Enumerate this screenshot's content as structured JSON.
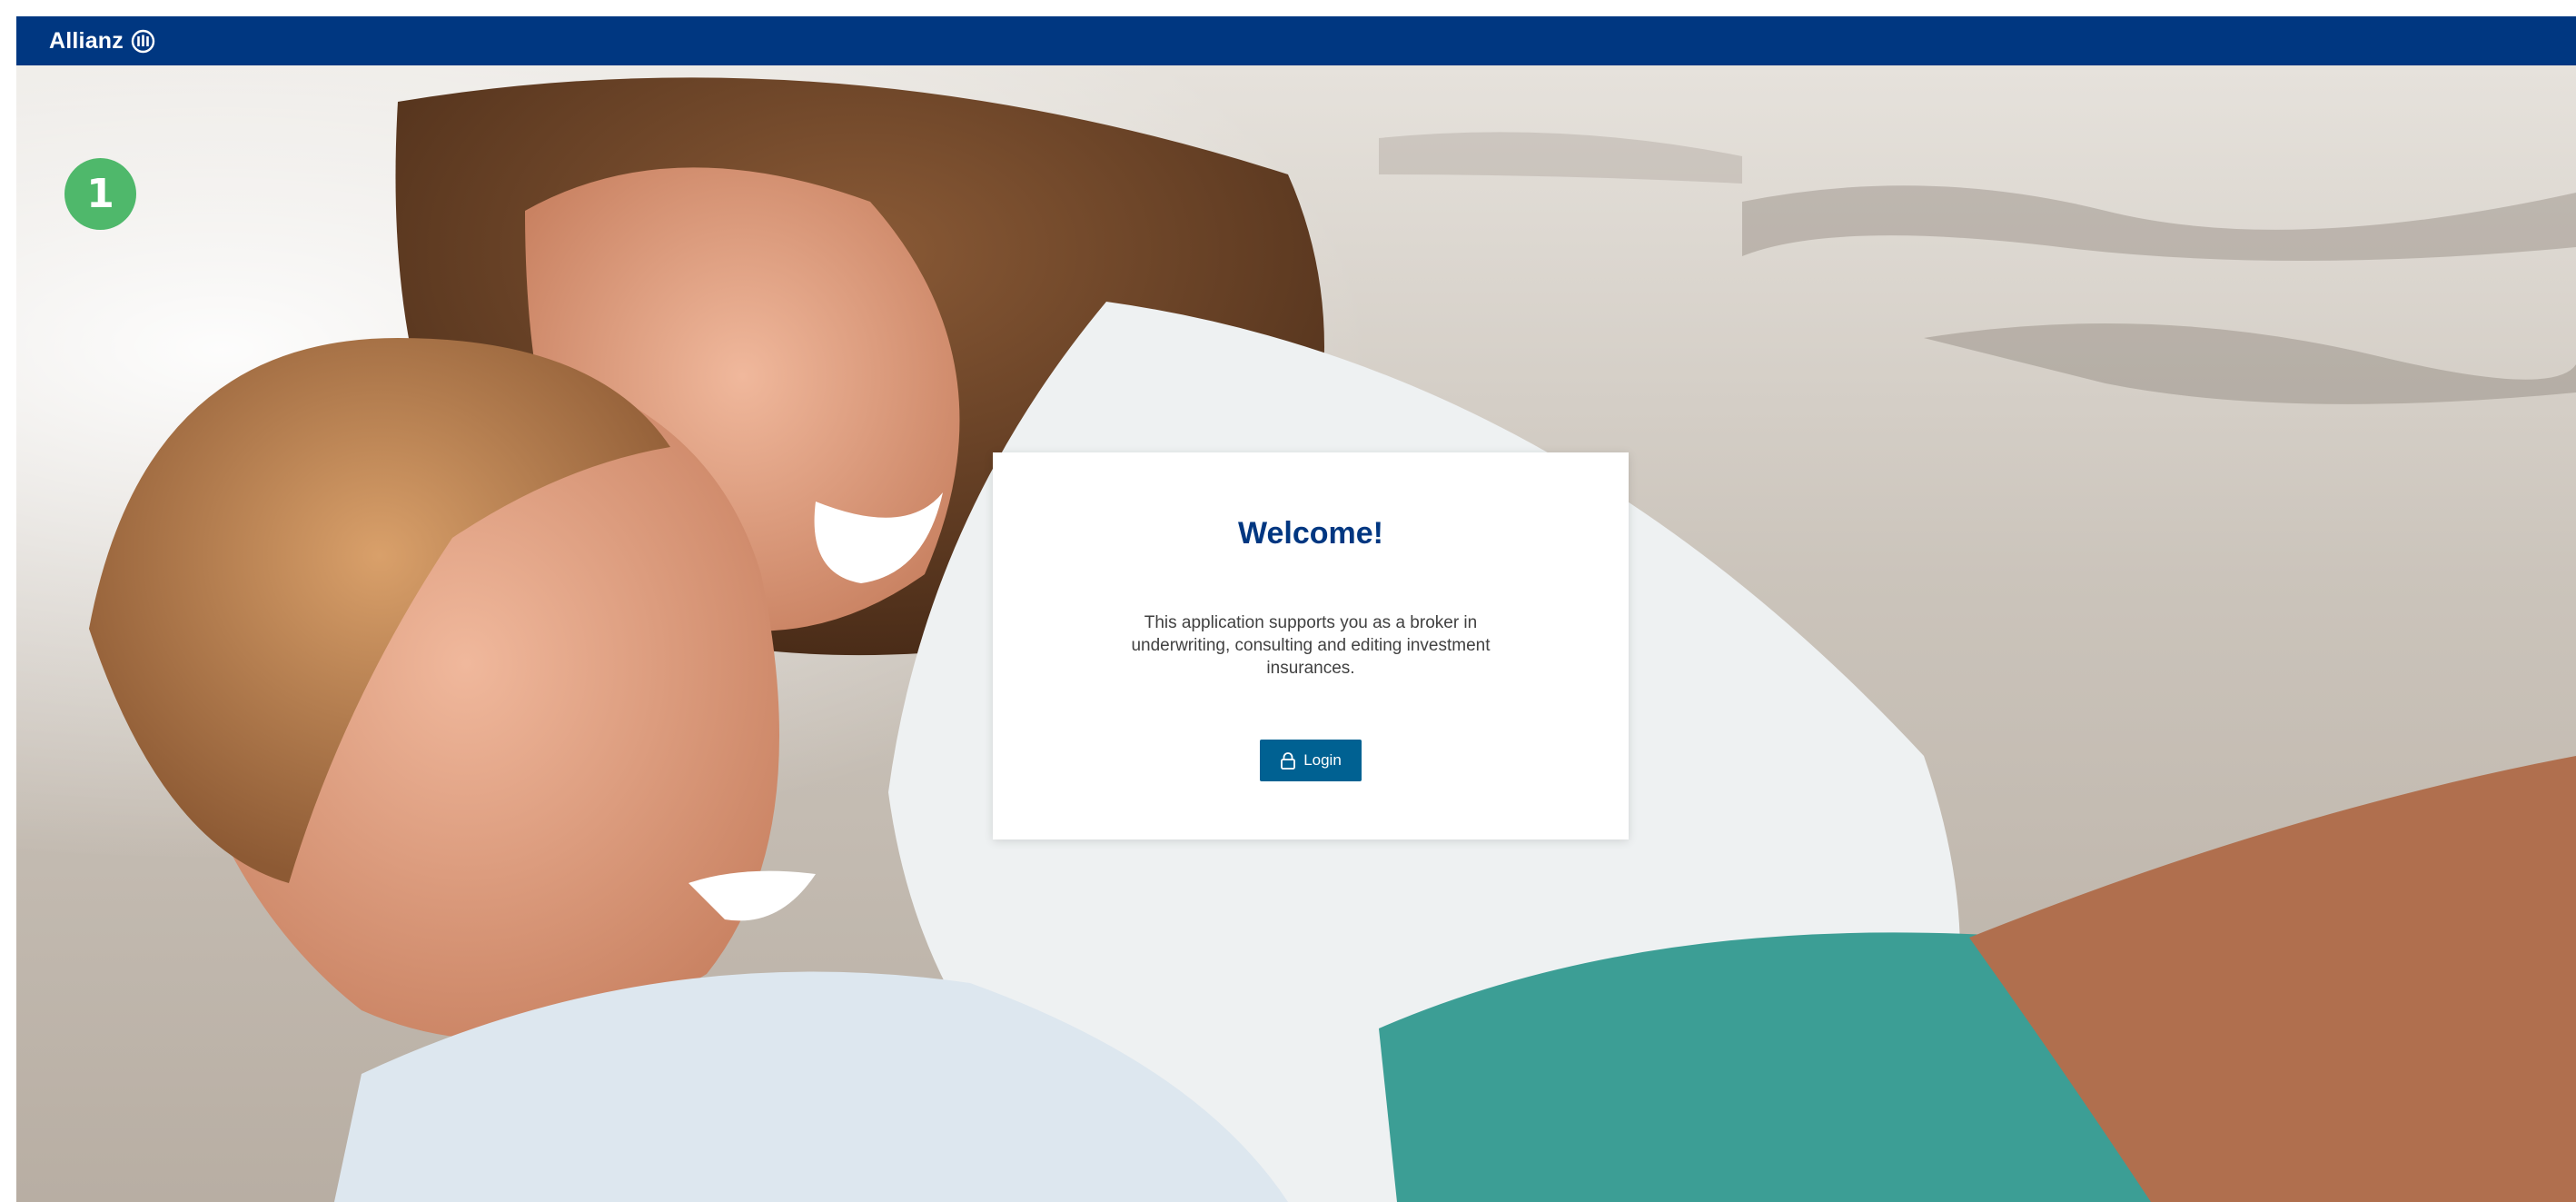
{
  "header": {
    "brand": "Allianz",
    "logo_icon": "allianz-eagle-icon",
    "background_color": "#003781"
  },
  "hero": {
    "image": "mother-and-child-at-beach-photo",
    "step_badge": "1",
    "badge_color": "#4fb86b"
  },
  "welcome": {
    "title": "Welcome!",
    "description": "This application supports you as a broker in underwriting, consulting and editing investment insurances.",
    "login_label": "Login",
    "login_icon": "lock-icon",
    "button_color": "#006192",
    "title_color": "#003781"
  }
}
